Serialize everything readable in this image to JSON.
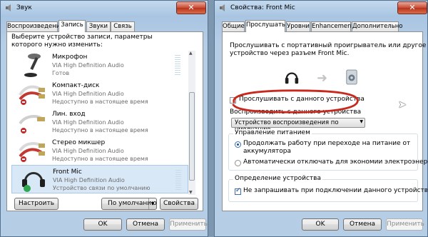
{
  "left": {
    "title": "Звук",
    "tabs": [
      "Воспроизведение",
      "Запись",
      "Звуки",
      "Связь"
    ],
    "instruction": "Выберите устройство записи, параметры которого нужно изменить:",
    "devices": [
      {
        "name": "Микрофон",
        "driver": "VIA High Definition Audio",
        "status": "Готов"
      },
      {
        "name": "Компакт-диск",
        "driver": "VIA High Definition Audio",
        "status": "Недоступно в настоящее время"
      },
      {
        "name": "Лин. вход",
        "driver": "VIA High Definition Audio",
        "status": "Недоступно в настоящее время"
      },
      {
        "name": "Стерео микшер",
        "driver": "VIA High Definition Audio",
        "status": "Недоступно в настоящее время"
      },
      {
        "name": "Front Mic",
        "driver": "VIA High Definition Audio",
        "status": "Устройство связи по умолчанию"
      }
    ],
    "buttons": {
      "configure": "Настроить",
      "default": "По умолчанию",
      "properties": "Свойства",
      "ok": "OK",
      "cancel": "Отмена",
      "apply": "Применить"
    }
  },
  "right": {
    "title": "Свойства: Front Mic",
    "tabs": [
      "Общие",
      "Прослушать",
      "Уровни",
      "Enhancements",
      "Дополнительно"
    ],
    "intro": [
      "Прослушивать с портативный проигрыватель или другое",
      "устройство через разъем Front Mic."
    ],
    "listen_checkbox": "Прослушивать с данного устройства",
    "playback_label": "Воспроизводить с данного устройства",
    "playback_value": "Устройство воспроизведения по умолчанию",
    "power_group": "Управление питанием",
    "power_opt1": [
      "Продолжать работу при переходе на питание от",
      "аккумулятора"
    ],
    "power_opt2": "Автоматически отключать для экономии электроэнергии",
    "detect_group": "Определение устройства",
    "detect_opt": "Не запрашивать при подключении данного устройства",
    "buttons": {
      "ok": "OK",
      "cancel": "Отмена",
      "apply": "Применить"
    }
  },
  "colors": {
    "annotation": "#c8291c",
    "selection": "#d9e8f6"
  }
}
